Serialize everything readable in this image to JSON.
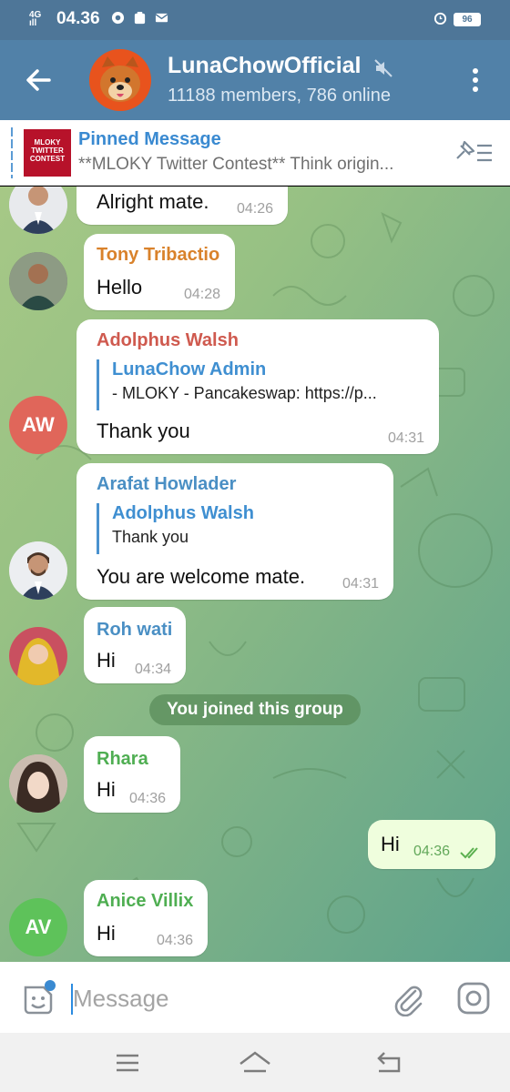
{
  "status_bar": {
    "network": "4G",
    "signal": "ıll",
    "time": "04.36",
    "battery": "96"
  },
  "header": {
    "title": "LunaChowOfficial",
    "subtitle": "11188 members, 786 online",
    "avatar_icon": "dog-icon"
  },
  "pinned": {
    "label": "Pinned Message",
    "text": "**MLOKY Twitter Contest**  Think origin...",
    "thumb_text": "MLOKY TWITTER CONTEST"
  },
  "messages": [
    {
      "sender": "",
      "text": "Alright mate.",
      "time": "04:26"
    },
    {
      "sender": "Tony Tribactio",
      "text": "Hello",
      "time": "04:28",
      "sender_color": "#d9822b"
    },
    {
      "sender": "Adolphus Walsh",
      "text": "Thank you",
      "time": "04:31",
      "sender_color": "#cf5a4f",
      "reply": {
        "name": "LunaChow Admin",
        "text": "- MLOKY - Pancakeswap: https://p..."
      },
      "avatar_initials": "AW",
      "avatar_color": "#e0665a"
    },
    {
      "sender": "Arafat Howlader",
      "text": "You are welcome mate.",
      "time": "04:31",
      "sender_color": "#4a8fc4",
      "reply": {
        "name": "Adolphus Walsh",
        "text": "Thank you"
      }
    },
    {
      "sender": "Roh wati",
      "text": "Hi",
      "time": "04:34",
      "sender_color": "#4a8fc4"
    },
    {
      "sender": "Rhara",
      "text": "Hi",
      "time": "04:36",
      "sender_color": "#4fae52"
    },
    {
      "sender": "",
      "text": "Hi",
      "time": "04:36",
      "outgoing": true
    },
    {
      "sender": "Anice Villix",
      "text": "Hi",
      "time": "04:36",
      "sender_color": "#4fae52",
      "avatar_initials": "AV",
      "avatar_color": "#5ec25a"
    }
  ],
  "service_message": "You joined this group",
  "composer": {
    "placeholder": "Message"
  },
  "colors": {
    "header": "#5181a8",
    "accent": "#3a8ad1",
    "outgoing_bubble": "#effedd"
  }
}
